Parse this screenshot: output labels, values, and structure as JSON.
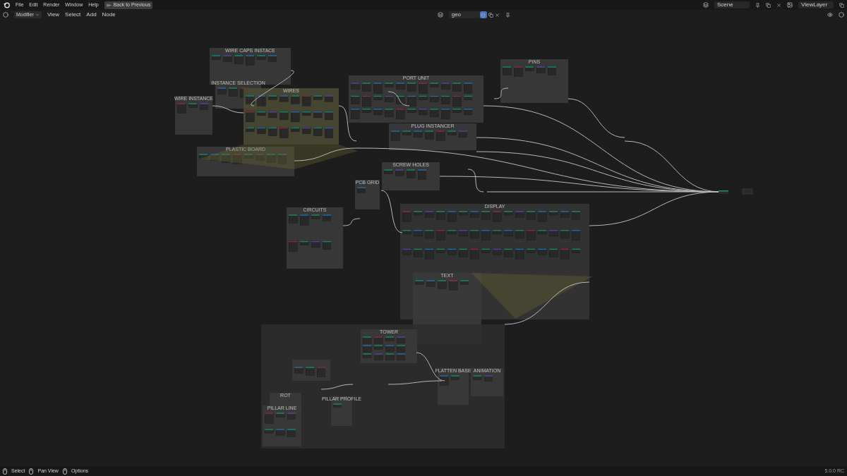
{
  "top_bar": {
    "menus": [
      "File",
      "Edit",
      "Render",
      "Window",
      "Help"
    ],
    "back_button": "Back to Previous",
    "scene": "Scene",
    "view_layer": "ViewLayer"
  },
  "header": {
    "mode": "Modifier",
    "menus": [
      "View",
      "Select",
      "Add",
      "Node"
    ],
    "node_tree": {
      "name": "geo",
      "fake_user": true
    }
  },
  "frames": [
    {
      "label": "WIRE CAPS INSTACE",
      "color": "#3a3a3a"
    },
    {
      "label": "INSTANCE SELECTION",
      "color": "#3a3a3a"
    },
    {
      "label": "WIRES",
      "color": "#4a4a34"
    },
    {
      "label": "WIRE INSTANCE",
      "color": "#3a3a3a"
    },
    {
      "label": "PLASTIC BOARD",
      "color": "#3a3a3a"
    },
    {
      "label": "PORT UNIT",
      "color": "#3a3a3a"
    },
    {
      "label": "PINS",
      "color": "#3a3a3a"
    },
    {
      "label": "PLUG INSTANCER",
      "color": "#3a3a3a"
    },
    {
      "label": "SCREW HOLES",
      "color": "#3a3a3a"
    },
    {
      "label": "PCB GRID",
      "color": "#3a3a3a"
    },
    {
      "label": "CIRCUITS",
      "color": "#3a3a3a"
    },
    {
      "label": "DISPLAY",
      "color": "#353535"
    },
    {
      "label": "TEXT",
      "color": "#3a3a3a"
    },
    {
      "color": "#2e2e2e"
    },
    {
      "label": "TOWER",
      "color": "#3a3a3a"
    },
    {
      "label": "FLATTEN BASE",
      "color": "#3a3a3a"
    },
    {
      "label": "ANIMATION",
      "color": "#3a3a3a"
    },
    {
      "color": "#3a3a3a"
    },
    {
      "label": "ROT",
      "color": "#3a3a3a"
    },
    {
      "label": "PILLAR LINE",
      "color": "#3a3a3a"
    },
    {
      "label": "PILLAR PROFILE",
      "color": "#3a3a3a"
    }
  ],
  "status_bar": {
    "hints": [
      "Select",
      "Pan View",
      "Options"
    ],
    "version": "5.0.0 RC"
  }
}
